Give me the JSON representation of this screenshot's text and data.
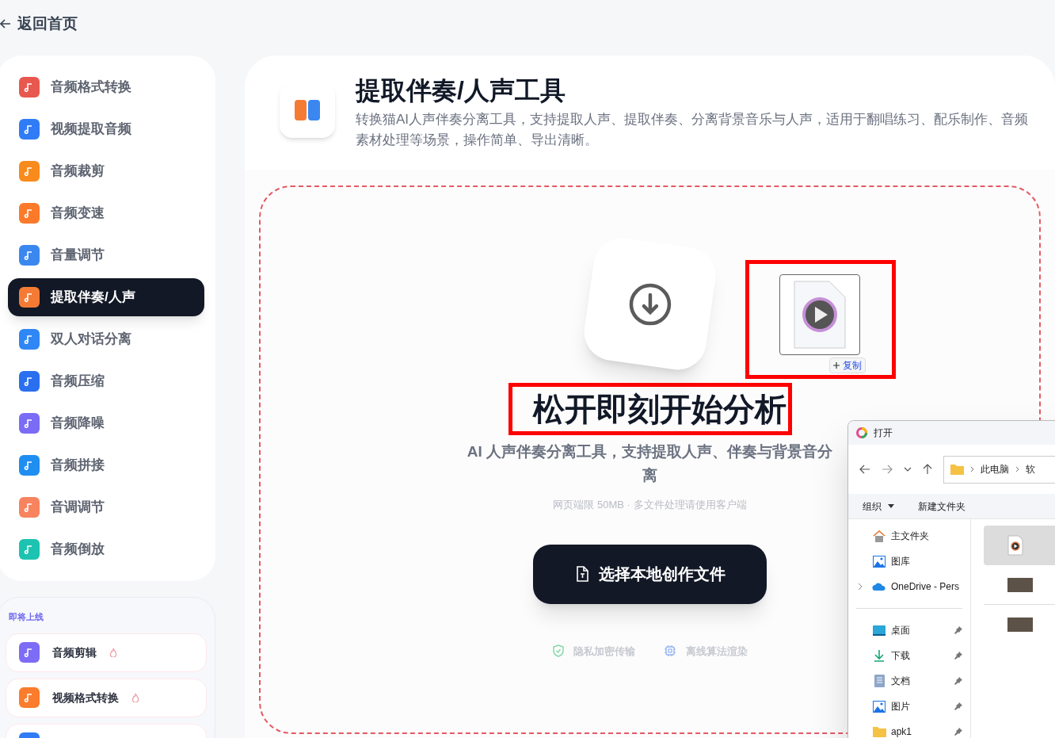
{
  "back_link": {
    "label": "返回首页"
  },
  "sidebar": {
    "items": [
      {
        "label": "音频格式转换",
        "color": "#e8584f",
        "selected": false
      },
      {
        "label": "视频提取音频",
        "color": "#2f7cf6",
        "selected": false
      },
      {
        "label": "音频裁剪",
        "color": "#f98a1c",
        "selected": false
      },
      {
        "label": "音频变速",
        "color": "#fb7a2a",
        "selected": false
      },
      {
        "label": "音量调节",
        "color": "#3b87f0",
        "selected": false
      },
      {
        "label": "提取伴奏/人声",
        "color": "#f57b35",
        "selected": true
      },
      {
        "label": "双人对话分离",
        "color": "#2f86f5",
        "selected": false
      },
      {
        "label": "音频压缩",
        "color": "#2a6ff0",
        "selected": false
      },
      {
        "label": "音频降噪",
        "color": "#7b6cf6",
        "selected": false
      },
      {
        "label": "音频拼接",
        "color": "#1f8ef1",
        "selected": false
      },
      {
        "label": "音调调节",
        "color": "#f7845f",
        "selected": false
      },
      {
        "label": "音频倒放",
        "color": "#1cc3b0",
        "selected": false
      }
    ]
  },
  "coming_soon": {
    "title": "即将上线",
    "items": [
      {
        "label": "音频剪辑",
        "color": "#7d6cf5",
        "hot": true
      },
      {
        "label": "视频格式转换",
        "color": "#fb7c2c",
        "hot": true
      },
      {
        "color": "#2f7cf6",
        "hot": false
      }
    ]
  },
  "tool": {
    "title": "提取伴奏/人声工具",
    "description": "转换猫AI人声伴奏分离工具，支持提取人声、提取伴奏、分离背景音乐与人声，适用于翻唱练习、配乐制作、音频素材处理等场景，操作简单、导出清晰。"
  },
  "drop_zone": {
    "copy_badge": "复制",
    "heading": "松开即刻开始分析",
    "subheading": "AI 人声伴奏分离工具，支持提取人声、伴奏与背景音分离",
    "limit_note": "网页端限 50MB · 多文件处理请使用客户端",
    "button": "选择本地创作文件",
    "features": [
      {
        "kind": "privacy",
        "label": "隐私加密传输"
      },
      {
        "kind": "offline",
        "label": "离线算法渲染"
      }
    ]
  },
  "open_dialog": {
    "title": "打开",
    "breadcrumb": [
      "此电脑",
      "软"
    ],
    "toolbar": [
      "组织",
      "新建文件夹"
    ],
    "nav": [
      {
        "kind": "home",
        "label": "主文件夹",
        "pinned": false,
        "expandable": false
      },
      {
        "kind": "gallery",
        "label": "图库",
        "pinned": false,
        "expandable": false
      },
      {
        "kind": "cloud",
        "label": "OneDrive - Pers",
        "pinned": false,
        "expandable": true
      },
      {
        "kind": "divider"
      },
      {
        "kind": "desktop",
        "label": "桌面",
        "pinned": true,
        "expandable": false
      },
      {
        "kind": "download",
        "label": "下载",
        "pinned": true,
        "expandable": false
      },
      {
        "kind": "document",
        "label": "文档",
        "pinned": true,
        "expandable": false
      },
      {
        "kind": "gallery",
        "label": "图片",
        "pinned": true,
        "expandable": false
      },
      {
        "kind": "folder",
        "label": "apk1",
        "pinned": true,
        "expandable": false
      }
    ],
    "files": [
      {
        "kind": "audio",
        "selected": true
      },
      {
        "kind": "video",
        "selected": false
      },
      {
        "kind": "video",
        "selected": false
      }
    ]
  }
}
